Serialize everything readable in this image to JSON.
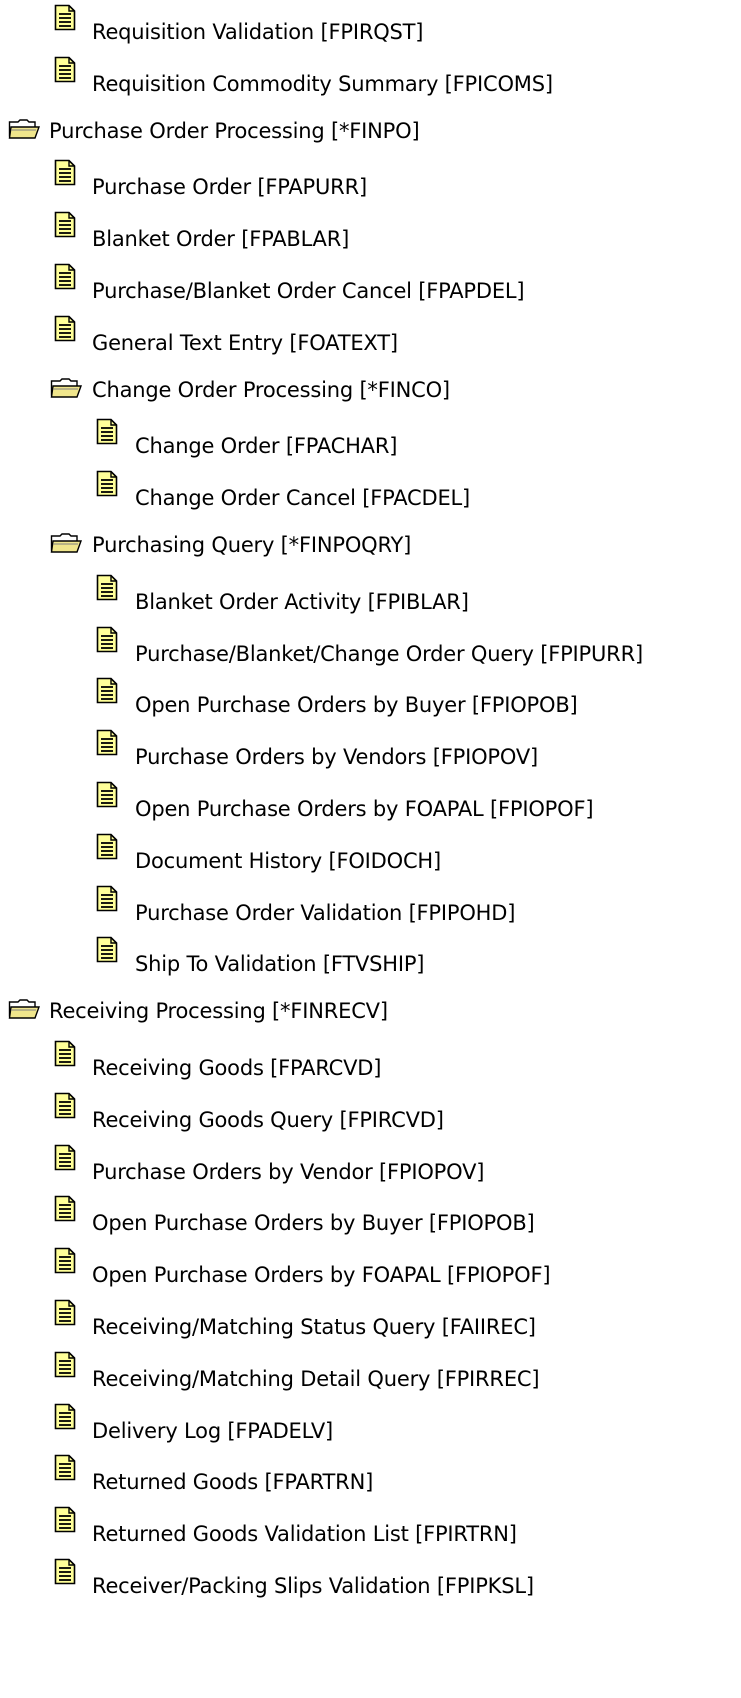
{
  "tree": {
    "nodes": [
      {
        "type": "doc",
        "level": 1,
        "label": "Requisition Validation [FPIRQST]"
      },
      {
        "type": "doc",
        "level": 1,
        "label": "Requisition Commodity Summary [FPICOMS]"
      },
      {
        "type": "folder",
        "level": 0,
        "label": "Purchase Order Processing [*FINPO]"
      },
      {
        "type": "doc",
        "level": 1,
        "label": "Purchase Order [FPAPURR]"
      },
      {
        "type": "doc",
        "level": 1,
        "label": "Blanket Order [FPABLAR]"
      },
      {
        "type": "doc",
        "level": 1,
        "label": "Purchase/Blanket Order Cancel [FPAPDEL]"
      },
      {
        "type": "doc",
        "level": 1,
        "label": "General Text Entry [FOATEXT]"
      },
      {
        "type": "folder",
        "level": 1,
        "label": "Change Order Processing [*FINCO]"
      },
      {
        "type": "doc",
        "level": 2,
        "label": "Change Order [FPACHAR]"
      },
      {
        "type": "doc",
        "level": 2,
        "label": "Change Order Cancel [FPACDEL]"
      },
      {
        "type": "folder",
        "level": 1,
        "label": "Purchasing Query [*FINPOQRY]"
      },
      {
        "type": "doc",
        "level": 2,
        "label": "Blanket Order Activity [FPIBLAR]"
      },
      {
        "type": "doc",
        "level": 2,
        "label": "Purchase/Blanket/Change Order Query [FPIPURR]"
      },
      {
        "type": "doc",
        "level": 2,
        "label": "Open Purchase Orders by Buyer [FPIOPOB]"
      },
      {
        "type": "doc",
        "level": 2,
        "label": "Purchase Orders by Vendors [FPIOPOV]"
      },
      {
        "type": "doc",
        "level": 2,
        "label": "Open Purchase Orders by FOAPAL [FPIOPOF]"
      },
      {
        "type": "doc",
        "level": 2,
        "label": "Document History [FOIDOCH]"
      },
      {
        "type": "doc",
        "level": 2,
        "label": "Purchase Order Validation [FPIPOHD]"
      },
      {
        "type": "doc",
        "level": 2,
        "label": "Ship To Validation [FTVSHIP]"
      },
      {
        "type": "folder",
        "level": 0,
        "label": "Receiving Processing [*FINRECV]"
      },
      {
        "type": "doc",
        "level": 1,
        "label": "Receiving Goods [FPARCVD]"
      },
      {
        "type": "doc",
        "level": 1,
        "label": "Receiving Goods Query [FPIRCVD]"
      },
      {
        "type": "doc",
        "level": 1,
        "label": "Purchase Orders by Vendor [FPIOPOV]"
      },
      {
        "type": "doc",
        "level": 1,
        "label": "Open Purchase Orders by Buyer [FPIOPOB]"
      },
      {
        "type": "doc",
        "level": 1,
        "label": "Open Purchase Orders by FOAPAL [FPIOPOF]"
      },
      {
        "type": "doc",
        "level": 1,
        "label": "Receiving/Matching Status Query [FAIIREC]"
      },
      {
        "type": "doc",
        "level": 1,
        "label": "Receiving/Matching Detail Query [FPIRREC]"
      },
      {
        "type": "doc",
        "level": 1,
        "label": "Delivery Log [FPADELV]"
      },
      {
        "type": "doc",
        "level": 1,
        "label": "Returned Goods [FPARTRN]"
      },
      {
        "type": "doc",
        "level": 1,
        "label": "Returned Goods Validation List [FPIRTRN]"
      },
      {
        "type": "doc",
        "level": 1,
        "label": "Receiver/Packing Slips Validation [FPIPKSL]"
      }
    ]
  },
  "colors": {
    "doc_icon_fill": "#ffff99",
    "folder_icon_fill": "#f0e68c",
    "text": "#000000"
  }
}
